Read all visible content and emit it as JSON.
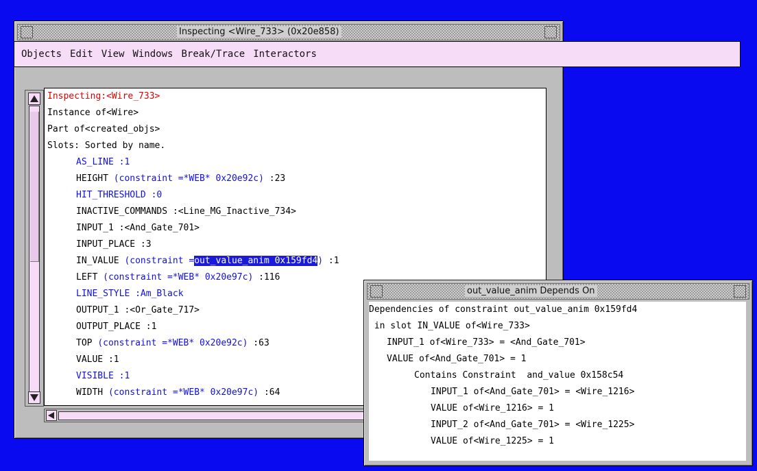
{
  "inspector": {
    "title": "Inspecting <Wire_733> (0x20e858)",
    "menu": [
      "Objects",
      "Edit",
      "View",
      "Windows",
      "Break/Trace",
      "Interactors"
    ],
    "header": {
      "inspecting_label": "Inspecting:",
      "inspecting_value": "<Wire_733>",
      "instance_of": "Instance of<Wire>",
      "part_of": "Part of<created_objs>",
      "slots": "Slots: Sorted by name."
    },
    "slots": {
      "as_line": "AS_LINE :1",
      "height_name": "HEIGHT",
      "height_constraint": "(constraint =*WEB* 0x20e92c)",
      "height_value": ":23",
      "hit_threshold": "HIT_THRESHOLD :0",
      "inactive_commands": "INACTIVE_COMMANDS :<Line_MG_Inactive_734>",
      "input_1": "INPUT_1 :<And_Gate_701>",
      "input_place": "INPUT_PLACE :3",
      "in_value_name": "IN_VALUE",
      "in_value_constraint_prefix": "(constraint =",
      "in_value_constraint_selected": "out_value_anim 0x159fd4",
      "in_value_constraint_suffix": ")",
      "in_value_value": ":1",
      "left_name": "LEFT",
      "left_constraint": "(constraint =*WEB* 0x20e97c)",
      "left_value": ":116",
      "line_style": "LINE_STYLE :Am_Black",
      "output_1": "OUTPUT_1 :<Or_Gate_717>",
      "output_place": "OUTPUT_PLACE :1",
      "top_name": "TOP",
      "top_constraint": "(constraint =*WEB* 0x20e92c)",
      "top_value": ":63",
      "value": "VALUE :1",
      "visible": "VISIBLE :1",
      "width_name": "WIDTH",
      "width_constraint": "(constraint =*WEB* 0x20e97c)",
      "width_value": ":64"
    }
  },
  "depends": {
    "title": "out_value_anim Depends On",
    "line1": "Dependencies of constraint out_value_anim 0x159fd4",
    "line2": " in slot IN_VALUE of<Wire_733>",
    "line3": "INPUT_1 of<Wire_733> = <And_Gate_701>",
    "line4": "VALUE of<And_Gate_701> = 1",
    "line5": "Contains Constraint  and_value 0x158c54",
    "line6": "INPUT_1 of<And_Gate_701> = <Wire_1216>",
    "line7": "VALUE of<Wire_1216> = 1",
    "line8": "INPUT_2 of<And_Gate_701> = <Wire_1225>",
    "line9": "VALUE of<Wire_1225> = 1"
  },
  "colors": {
    "desktop": "#0a0af0",
    "menubar": "#f7dcf7",
    "red_text": "#e00000",
    "blue_text": "#1010e0",
    "selection": "#1a1ad8"
  },
  "icons": [
    "scroll-up-arrow-icon",
    "scroll-down-arrow-icon",
    "scroll-left-arrow-icon"
  ]
}
